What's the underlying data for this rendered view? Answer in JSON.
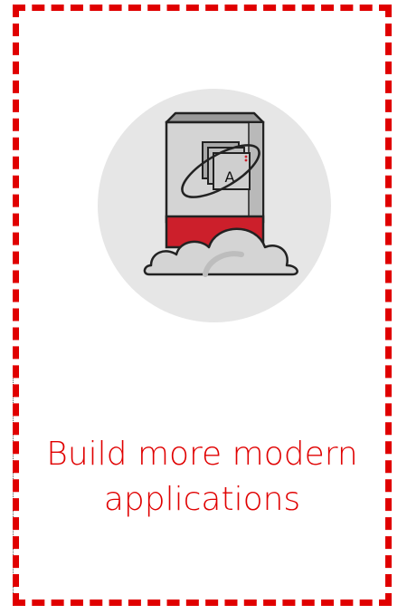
{
  "card": {
    "headline": "Build more modern applications",
    "accent_color": "#e00000",
    "icon": "server-cloud-app-icon",
    "icon_badge_letter": "A"
  }
}
